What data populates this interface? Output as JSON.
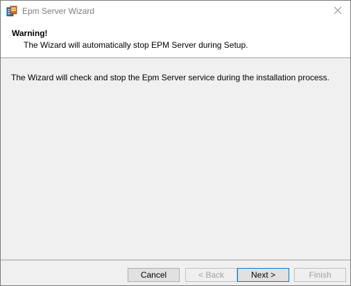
{
  "window": {
    "title": "Epm Server Wizard",
    "icon": "server-wizard-icon",
    "close_icon": "close-icon"
  },
  "header": {
    "title": "Warning!",
    "subtitle": "The Wizard will automatically stop EPM Server during Setup."
  },
  "content": {
    "message": "The Wizard will check and stop the Epm Server service during the installation process."
  },
  "buttons": {
    "cancel": "Cancel",
    "back": "< Back",
    "next": "Next >",
    "finish": "Finish"
  },
  "colors": {
    "accent": "#0078d7",
    "disabled_text": "#a0a0a0"
  }
}
